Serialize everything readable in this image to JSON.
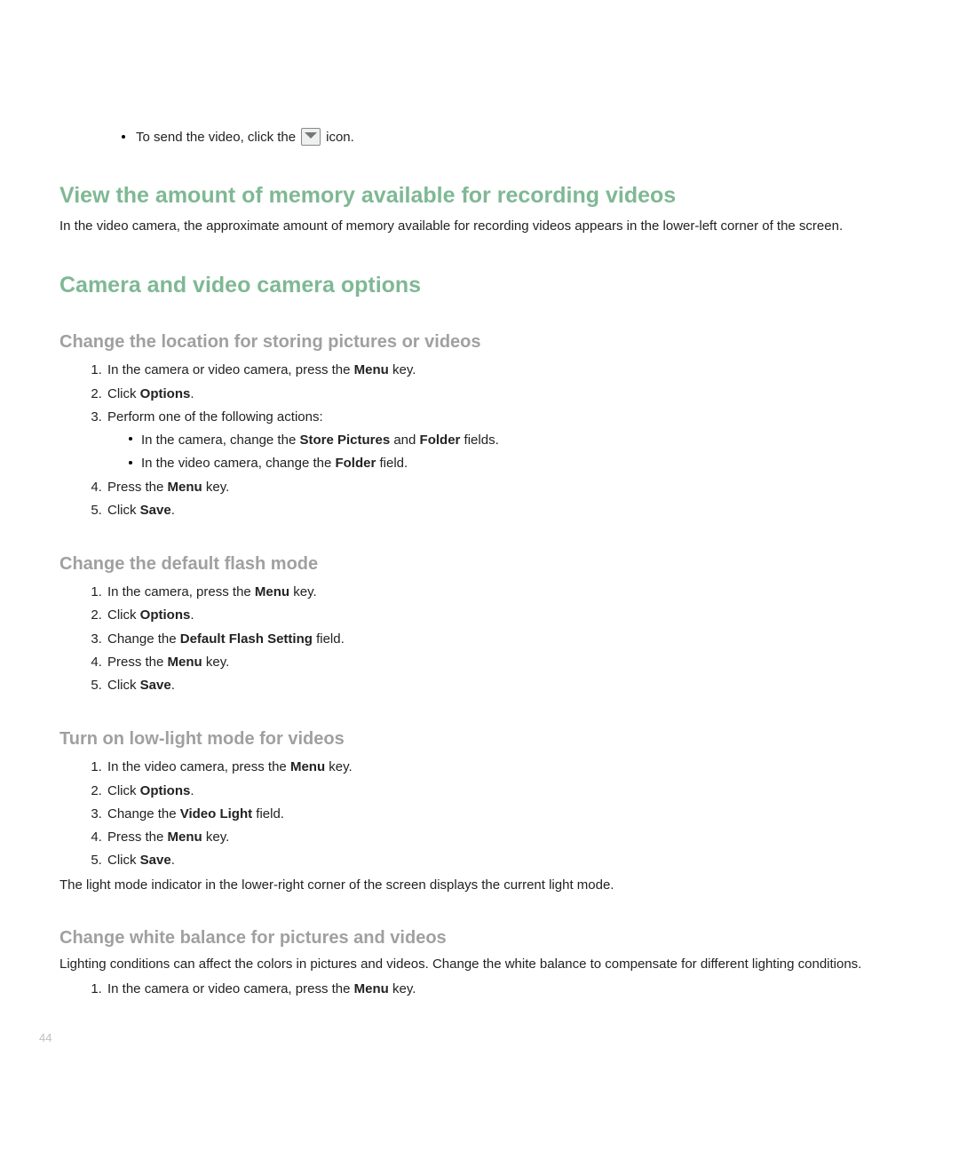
{
  "top": {
    "bullet_pre": "To send the video, click the ",
    "bullet_post": " icon."
  },
  "h1_memory": "View the amount of memory available for recording videos",
  "p_memory": "In the video camera, the approximate amount of memory available for recording videos appears in the lower-left corner of the screen.",
  "h1_options": "Camera and video camera options",
  "sec_location": {
    "heading": "Change the location for storing pictures or videos",
    "s1_pre": "In the camera or video camera, press the ",
    "s1_b": "Menu",
    "s1_post": " key.",
    "s2_pre": "Click ",
    "s2_b": "Options",
    "s2_post": ".",
    "s3": "Perform one of the following actions:",
    "s3a_pre": "In the camera, change the ",
    "s3a_b1": "Store Pictures",
    "s3a_mid": " and ",
    "s3a_b2": "Folder",
    "s3a_post": " fields.",
    "s3b_pre": "In the video camera, change the ",
    "s3b_b": "Folder",
    "s3b_post": " field.",
    "s4_pre": "Press the ",
    "s4_b": "Menu",
    "s4_post": " key.",
    "s5_pre": "Click ",
    "s5_b": "Save",
    "s5_post": "."
  },
  "sec_flash": {
    "heading": "Change the default flash mode",
    "s1_pre": "In the camera, press the ",
    "s1_b": "Menu",
    "s1_post": " key.",
    "s2_pre": "Click ",
    "s2_b": "Options",
    "s2_post": ".",
    "s3_pre": "Change the ",
    "s3_b": "Default Flash Setting",
    "s3_post": " field.",
    "s4_pre": "Press the ",
    "s4_b": "Menu",
    "s4_post": " key.",
    "s5_pre": "Click ",
    "s5_b": "Save",
    "s5_post": "."
  },
  "sec_lowlight": {
    "heading": "Turn on low-light mode for videos",
    "s1_pre": "In the video camera, press the ",
    "s1_b": "Menu",
    "s1_post": " key.",
    "s2_pre": "Click ",
    "s2_b": "Options",
    "s2_post": ".",
    "s3_pre": "Change the ",
    "s3_b": "Video Light",
    "s3_post": " field.",
    "s4_pre": "Press the ",
    "s4_b": "Menu",
    "s4_post": " key.",
    "s5_pre": "Click ",
    "s5_b": "Save",
    "s5_post": ".",
    "note": "The light mode indicator in the lower-right corner of the screen displays the current light mode."
  },
  "sec_wb": {
    "heading": "Change white balance for pictures and videos",
    "intro": "Lighting conditions can affect the colors in pictures and videos. Change the white balance to compensate for different lighting conditions.",
    "s1_pre": "In the camera or video camera, press the ",
    "s1_b": "Menu",
    "s1_post": " key."
  },
  "page_number": "44"
}
